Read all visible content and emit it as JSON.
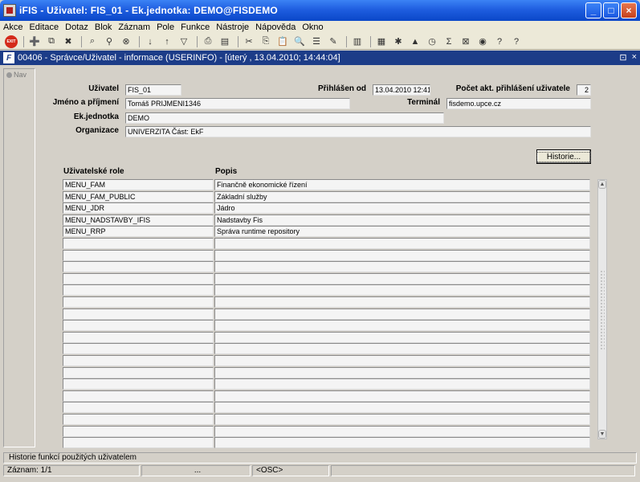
{
  "window": {
    "title": "iFIS - Uživatel: FIS_01 - Ek.jednotka: DEMO@FISDEMO"
  },
  "menu": [
    "Akce",
    "Editace",
    "Dotaz",
    "Blok",
    "Záznam",
    "Pole",
    "Funkce",
    "Nástroje",
    "Nápověda",
    "Okno"
  ],
  "toolbar": {
    "exit_label": "EXIT"
  },
  "inner": {
    "title": "00406 - Správce/Uživatel - informace (USERINFO) - [úterý , 13.04.2010; 14:44:04]",
    "restore": "⊡",
    "close": "×"
  },
  "nav": {
    "label": "Nav"
  },
  "form": {
    "uzivatel_label": "Uživatel",
    "uzivatel_value": "FIS_01",
    "prihlasen_label": "Přihlášen od",
    "prihlasen_value": "13.04.2010 12:41:",
    "pocet_label": "Počet akt. přihlášení uživatele",
    "pocet_value": "2",
    "jmeno_label": "Jméno a příjmení",
    "jmeno_value": "Tomáš PRIJMENI1346",
    "terminal_label": "Terminál",
    "terminal_value": "fisdemo.upce.cz",
    "ekjednotka_label": "Ek.jednotka",
    "ekjednotka_value": "DEMO",
    "organizace_label": "Organizace",
    "organizace_value": "UNIVERZITA Část: EkF",
    "historie_button": "Historie..."
  },
  "table": {
    "col_role": "Uživatelské role",
    "col_popis": "Popis",
    "rows": [
      {
        "role": "MENU_FAM",
        "popis": "Finančně ekonomické řízení"
      },
      {
        "role": "MENU_FAM_PUBLIC",
        "popis": "Základní služby"
      },
      {
        "role": "MENU_JDR",
        "popis": "Jádro"
      },
      {
        "role": "MENU_NADSTAVBY_IFIS",
        "popis": "Nadstavby Fis"
      },
      {
        "role": "MENU_RRP",
        "popis": "Správa runtime repository"
      }
    ],
    "empty_rows": 18
  },
  "status": {
    "hint": "Historie funkcí použitých uživatelem",
    "record": "Záznam: 1/1",
    "seg2": "...",
    "seg3": "<OSC>"
  }
}
